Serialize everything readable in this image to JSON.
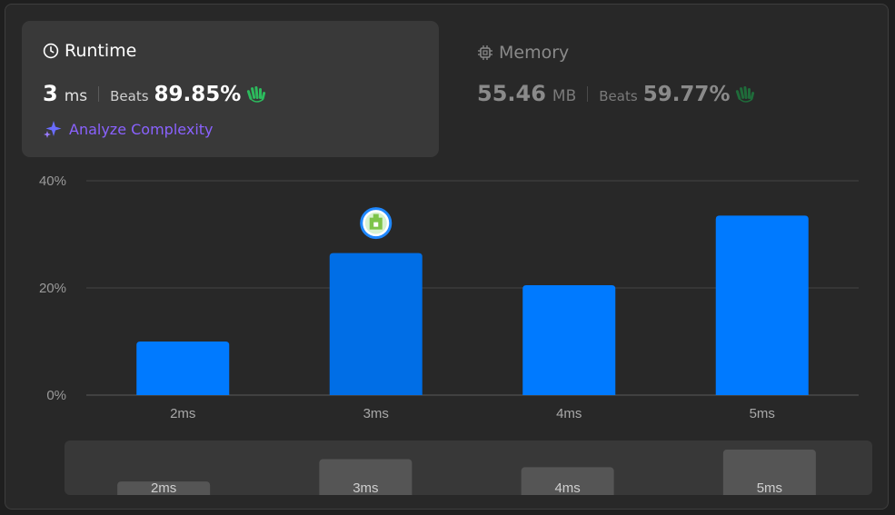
{
  "runtime": {
    "title": "Runtime",
    "value": "3",
    "unit": "ms",
    "beats_label": "Beats",
    "beats_pct": "89.85%"
  },
  "memory": {
    "title": "Memory",
    "value": "55.46",
    "unit": "MB",
    "beats_label": "Beats",
    "beats_pct": "59.77%"
  },
  "analyze_label": "Analyze Complexity",
  "colors": {
    "bar": "#007aff",
    "bar_highlight": "#006ee6",
    "accent_green": "#2cbb5d",
    "analyze_text": "#8a62ff"
  },
  "icons": {
    "runtime": "clock-icon",
    "memory": "chip-icon",
    "beats": "waving-hands-icon",
    "analyze": "sparkle-icon",
    "current_bar": "user-avatar-icon"
  },
  "chart_data": {
    "type": "bar",
    "categories": [
      "2ms",
      "3ms",
      "4ms",
      "5ms"
    ],
    "values": [
      10,
      26.5,
      20.5,
      33.5
    ],
    "highlight_index": 1,
    "ylim": [
      0,
      40
    ],
    "yticks": [
      0,
      20,
      40
    ],
    "ytick_labels": [
      "0%",
      "20%",
      "40%"
    ],
    "grid": true,
    "xlabel": "",
    "ylabel": "",
    "title": ""
  },
  "overview": {
    "categories": [
      "2ms",
      "3ms",
      "4ms",
      "5ms"
    ],
    "values": [
      10,
      26.5,
      20.5,
      33.5
    ]
  }
}
